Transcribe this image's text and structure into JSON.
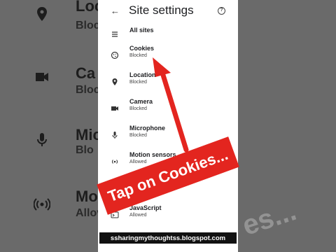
{
  "background": {
    "rows": [
      {
        "title": "Loc",
        "sub": "Blocke"
      },
      {
        "title": "Ca",
        "sub": "Block"
      },
      {
        "title": "Mic",
        "sub": "Blo"
      },
      {
        "title": "Mo",
        "sub": "Allov"
      }
    ]
  },
  "header": {
    "back_icon": "arrow-left-icon",
    "title": "Site settings",
    "help_label": "?"
  },
  "items": [
    {
      "label": "All sites",
      "sub": "",
      "icon": "list-icon"
    },
    {
      "label": "Cookies",
      "sub": "Blocked",
      "icon": "cookie-icon"
    },
    {
      "label": "Location",
      "sub": "Blocked",
      "icon": "location-pin-icon"
    },
    {
      "label": "Camera",
      "sub": "Blocked",
      "icon": "camera-icon"
    },
    {
      "label": "Microphone",
      "sub": "Blocked",
      "icon": "microphone-icon"
    },
    {
      "label": "Motion sensors",
      "sub": "Allowed",
      "icon": "motion-sensor-icon"
    },
    {
      "label": "",
      "sub": "",
      "icon": "notification-icon"
    },
    {
      "label": "JavaScript",
      "sub": "Allowed",
      "icon": "javascript-icon"
    }
  ],
  "annotation": {
    "banner_text": "Tap on Cookies...",
    "watermark_text": "es...",
    "url_text": "ssharingmythoughtss.blogspot.com",
    "accent_color": "#e3251f"
  }
}
